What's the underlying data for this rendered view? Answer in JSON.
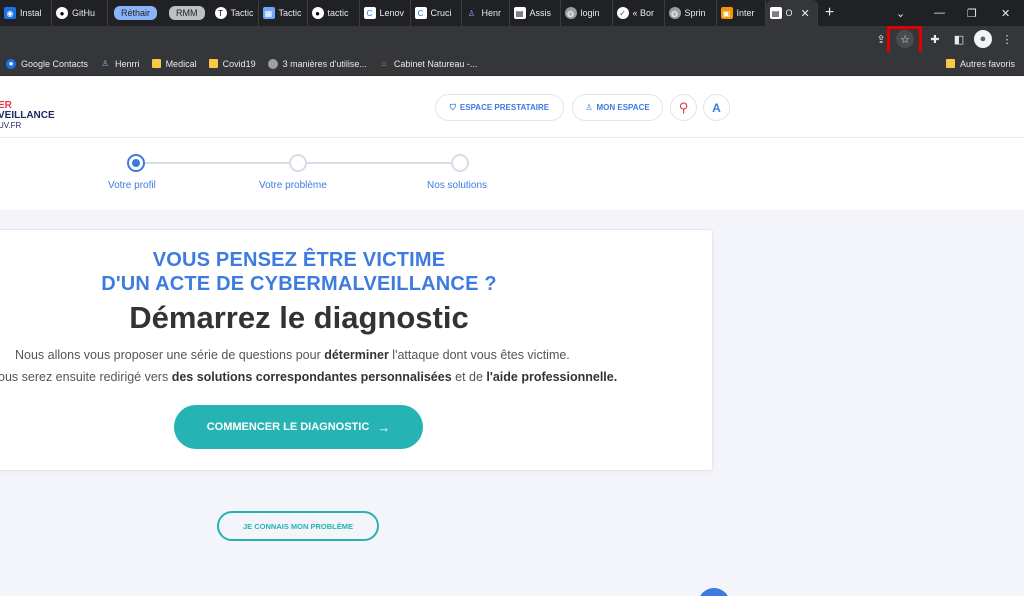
{
  "browser": {
    "tabs": [
      {
        "label": "Instal",
        "icon": "edge-icon",
        "color": "#1a73e8"
      },
      {
        "label": "GitHu",
        "icon": "github-icon",
        "color": "#ffffff"
      }
    ],
    "groups": {
      "rethair": {
        "label": "Réthair",
        "color": "#8ab4f8"
      },
      "rmm": {
        "label": "RMM",
        "color": "#bdc1c6"
      }
    },
    "tabs_group2": [
      {
        "label": "Tactic",
        "icon": "t-icon"
      },
      {
        "label": "Tactic",
        "icon": "grid-icon"
      },
      {
        "label": "tactic",
        "icon": "github-icon"
      },
      {
        "label": "Lenov",
        "icon": "c-icon"
      },
      {
        "label": "Cruci",
        "icon": "c-icon"
      },
      {
        "label": "Henr",
        "icon": "person-icon"
      },
      {
        "label": "Assis",
        "icon": "doc-icon"
      },
      {
        "label": "login",
        "icon": "globe-icon"
      },
      {
        "label": "« Bor",
        "icon": "check-icon"
      },
      {
        "label": "Sprin",
        "icon": "globe-icon"
      },
      {
        "label": "Inter",
        "icon": "image-icon"
      },
      {
        "label": "O",
        "icon": "doc-icon"
      }
    ],
    "active_tab_close": "✕",
    "new_tab": "+",
    "window_controls": {
      "menu": "⌄",
      "minimize": "—",
      "restore": "❐",
      "close": "✕"
    }
  },
  "bookmarks": [
    {
      "label": "Google Contacts",
      "icon": "contacts-icon"
    },
    {
      "label": "Henrri",
      "icon": "person-icon"
    },
    {
      "label": "Medical",
      "icon": "folder-icon"
    },
    {
      "label": "Covid19",
      "icon": "folder-icon"
    },
    {
      "label": "3 manières d'utilise...",
      "icon": "globe-icon"
    },
    {
      "label": "Cabinet Natureau -...",
      "icon": "home-icon"
    }
  ],
  "bookmarks_other": "Autres favoris",
  "site": {
    "logo": {
      "line1": "ER",
      "line2": "VEILLANCE",
      "line3": "UV.FR"
    },
    "header": {
      "provider_button": "ESPACE PRESTATAIRE",
      "my_space_button": "MON ESPACE",
      "accessibility_button": "A"
    },
    "steps": [
      "Votre profil",
      "Votre problème",
      "Nos solutions"
    ],
    "card": {
      "subtitle_line1": "VOUS PENSEZ ÊTRE VICTIME",
      "subtitle_line2": "D'UN ACTE DE CYBERMALVEILLANCE ?",
      "title": "Démarrez le diagnostic",
      "desc1_pre": "Nous allons vous proposer une série de questions pour ",
      "desc1_bold": "déterminer",
      "desc1_post": " l'attaque dont vous êtes victime.",
      "desc2_pre": "ous serez ensuite redirigé vers ",
      "desc2_bold1": "des solutions correspondantes personnalisées",
      "desc2_mid": " et de ",
      "desc2_bold2": "l'aide professionnelle.",
      "cta": "COMMENCER LE DIAGNOSTIC",
      "cta_arrow": "→"
    },
    "know_problem_button": "JE CONNAIS MON PROBLÈME"
  },
  "colors": {
    "accent_blue": "#3d7be0",
    "teal": "#26b3b3",
    "highlight_red": "#e00000"
  }
}
